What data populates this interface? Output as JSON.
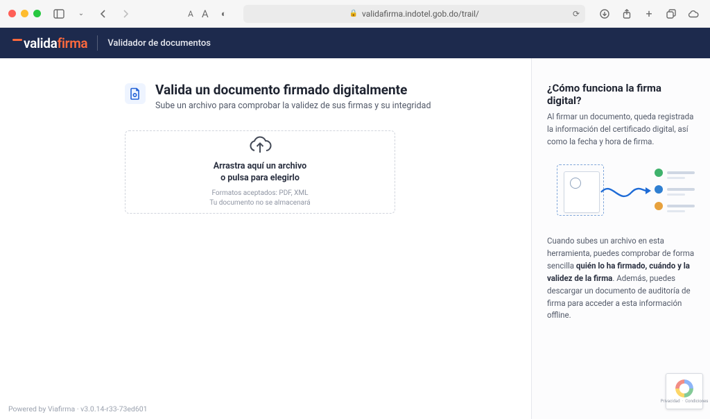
{
  "browser": {
    "url": "validafirma.indotel.gob.do/trail/"
  },
  "header": {
    "brand_prefix": "valida",
    "brand_suffix": "firma",
    "subtitle": "Validador de documentos"
  },
  "main": {
    "title": "Valida un documento firmado digitalmente",
    "subtitle": "Sube un archivo para comprobar la validez de sus firmas y su integridad",
    "dropzone": {
      "line1a": "Arrastra aquí un archivo",
      "line1b": "o pulsa para elegirlo",
      "formats": "Formatos aceptados: PDF, XML",
      "storage": "Tu documento no se almacenará"
    }
  },
  "sidebar": {
    "title": "¿Cómo funciona la firma digital?",
    "para1": "Al firmar un documento, queda registrada la información del certificado digital, así como la fecha y hora de firma.",
    "para2_pre": "Cuando subes un archivo en esta herramienta, puedes comprobar de forma sencilla ",
    "para2_bold": "quién lo ha firmado, cuándo y la validez de la firma",
    "para2_post": ". Además, puedes descargar un documento de auditoría de firma para acceder a esta información offline."
  },
  "footer": {
    "powered_by": "Powered by Viafirma",
    "sep": " · ",
    "version": "v3.0.14-r33-73ed601"
  },
  "recaptcha": {
    "label1": "Privacidad",
    "label2": "Condiciones"
  }
}
